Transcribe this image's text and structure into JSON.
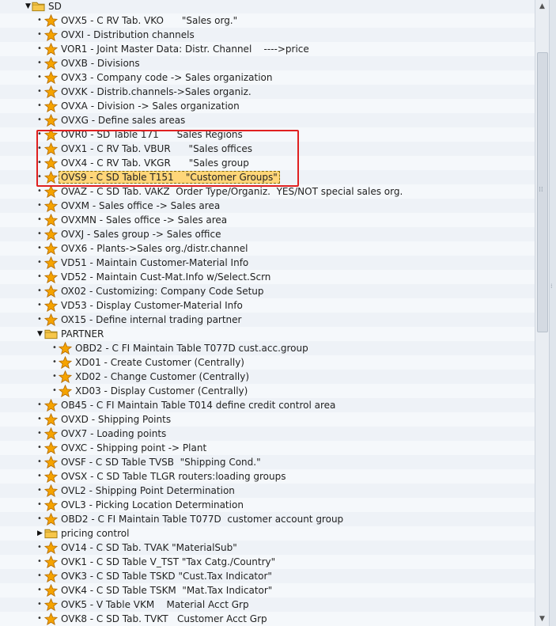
{
  "tree": {
    "items": [
      {
        "kind": "folder",
        "level": 1,
        "expanded": true,
        "text": "SD"
      },
      {
        "kind": "item",
        "level": 2,
        "text": "OVX5 - C RV Tab. VKO      \"Sales org.\""
      },
      {
        "kind": "item",
        "level": 2,
        "text": "OVXI - Distribution channels"
      },
      {
        "kind": "item",
        "level": 2,
        "text": "VOR1 - Joint Master Data: Distr. Channel    ---->price"
      },
      {
        "kind": "item",
        "level": 2,
        "text": "OVXB - Divisions"
      },
      {
        "kind": "item",
        "level": 2,
        "text": "OVX3 - Company code -> Sales organization"
      },
      {
        "kind": "item",
        "level": 2,
        "text": "OVXK - Distrib.channels->Sales organiz."
      },
      {
        "kind": "item",
        "level": 2,
        "text": "OVXA - Division -> Sales organization"
      },
      {
        "kind": "item",
        "level": 2,
        "text": "OVXG - Define sales areas"
      },
      {
        "kind": "item",
        "level": 2,
        "text": "OVR0 - SD Table 171      Sales Regions"
      },
      {
        "kind": "item",
        "level": 2,
        "text": "OVX1 - C RV Tab. VBUR      \"Sales offices"
      },
      {
        "kind": "item",
        "level": 2,
        "text": "OVX4 - C RV Tab. VKGR      \"Sales group"
      },
      {
        "kind": "item",
        "level": 2,
        "selected": true,
        "text": "OVS9 - C SD Table T151    \"Customer Groups\""
      },
      {
        "kind": "item",
        "level": 2,
        "text": "OVAZ - C SD Tab. VAKZ  Order Type/Organiz.  YES/NOT special sales org."
      },
      {
        "kind": "item",
        "level": 2,
        "text": "OVXM - Sales office -> Sales area"
      },
      {
        "kind": "item",
        "level": 2,
        "text": "OVXMN - Sales office -> Sales area"
      },
      {
        "kind": "item",
        "level": 2,
        "text": "OVXJ - Sales group -> Sales office"
      },
      {
        "kind": "item",
        "level": 2,
        "text": "OVX6 - Plants->Sales org./distr.channel"
      },
      {
        "kind": "item",
        "level": 2,
        "text": "VD51 - Maintain Customer-Material Info"
      },
      {
        "kind": "item",
        "level": 2,
        "text": "VD52 - Maintain Cust-Mat.Info w/Select.Scrn"
      },
      {
        "kind": "item",
        "level": 2,
        "text": "OX02 - Customizing: Company Code Setup"
      },
      {
        "kind": "item",
        "level": 2,
        "text": "VD53 - Display Customer-Material Info"
      },
      {
        "kind": "item",
        "level": 2,
        "text": "OX15 - Define internal trading partner"
      },
      {
        "kind": "folder",
        "level": 2,
        "expanded": true,
        "text": "PARTNER"
      },
      {
        "kind": "item",
        "level": 3,
        "text": "OBD2 - C FI Maintain Table T077D cust.acc.group"
      },
      {
        "kind": "item",
        "level": 3,
        "text": "XD01 - Create Customer (Centrally)"
      },
      {
        "kind": "item",
        "level": 3,
        "text": "XD02 - Change Customer (Centrally)"
      },
      {
        "kind": "item",
        "level": 3,
        "text": "XD03 - Display Customer (Centrally)"
      },
      {
        "kind": "item",
        "level": 2,
        "text": "OB45 - C FI Maintain Table T014 define credit control area"
      },
      {
        "kind": "item",
        "level": 2,
        "text": "OVXD - Shipping Points"
      },
      {
        "kind": "item",
        "level": 2,
        "text": "OVX7 - Loading points"
      },
      {
        "kind": "item",
        "level": 2,
        "text": "OVXC - Shipping point -> Plant"
      },
      {
        "kind": "item",
        "level": 2,
        "text": "OVSF - C SD Table TVSB  \"Shipping Cond.\""
      },
      {
        "kind": "item",
        "level": 2,
        "text": "OVSX - C SD Table TLGR routers:loading groups"
      },
      {
        "kind": "item",
        "level": 2,
        "text": "OVL2 - Shipping Point Determination"
      },
      {
        "kind": "item",
        "level": 2,
        "text": "OVL3 - Picking Location Determination"
      },
      {
        "kind": "item",
        "level": 2,
        "text": "OBD2 - C FI Maintain Table T077D  customer account group"
      },
      {
        "kind": "folder",
        "level": 2,
        "expanded": false,
        "text": "pricing control"
      },
      {
        "kind": "item",
        "level": 2,
        "text": "OV14 - C SD Tab. TVAK \"MaterialSub\""
      },
      {
        "kind": "item",
        "level": 2,
        "text": "OVK1 - C SD Table V_TST \"Tax Catg./Country\""
      },
      {
        "kind": "item",
        "level": 2,
        "text": "OVK3 - C SD Table TSKD \"Cust.Tax Indicator\""
      },
      {
        "kind": "item",
        "level": 2,
        "text": "OVK4 - C SD Table TSKM  \"Mat.Tax Indicator\""
      },
      {
        "kind": "item",
        "level": 2,
        "text": "OVK5 - V Table VKM    Material Acct Grp"
      },
      {
        "kind": "item",
        "level": 2,
        "text": "OVK8 - C SD Tab. TVKT   Customer Acct Grp"
      }
    ]
  },
  "icons": {
    "star": "favorite-star-icon",
    "folder": "folder-icon",
    "bullet": "bullet-icon",
    "expand": "tree-toggle-icon"
  },
  "colors": {
    "highlight_border": "#e02020",
    "selection_fill": "#ffd679",
    "star_fill": "#f5a300",
    "folder_fill": "#f6c64a"
  }
}
